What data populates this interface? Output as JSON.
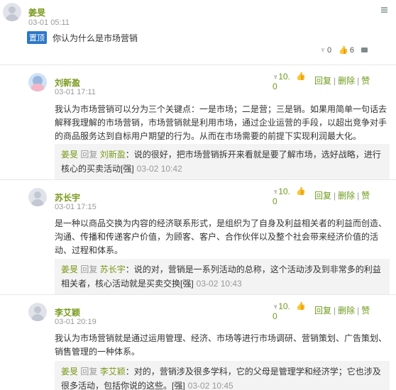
{
  "topic": {
    "author": "姜旻",
    "time": "03-01 05:11",
    "pin_label": "置顶",
    "title": "你认为什么是市场营销",
    "stats": {
      "pins": "0",
      "likes": "6",
      "comments": ""
    }
  },
  "posts": [
    {
      "author": "刘新盈",
      "time": "03-01 17:11",
      "vote_a": "10.",
      "vote_b": "0",
      "actions": {
        "reply": "回复",
        "delete": "删除",
        "thumbs": "赞"
      },
      "content": "我认为市场营销可以分为三个关键点：一是市场；二是营；三是销。如果用简单一句话去解释我理解的市场营销，市场营销就是利用市场，通过企业运营的手段，以超出竞争对手的商品服务达到自标用户期望的行为。从而在市场需要的前提下实现利润最大化。",
      "reply": {
        "from": "姜旻",
        "word": "回复",
        "to": "刘新盈",
        "text": "：说的很好，把市场营销拆开来看就是要了解市场，选好战略，进行核心的买卖活动[强]",
        "time": "03-02 10:42"
      }
    },
    {
      "author": "苏长宇",
      "time": "03-01 17:15",
      "vote_a": "10.",
      "vote_b": "0",
      "actions": {
        "reply": "回复",
        "delete": "删除",
        "thumbs": "赞"
      },
      "content": "是一种以商品交换为内容的经济联系形式，是组织为了自身及利益相关者的利益而创造、沟通、传播和传递客户价值，为顾客、客户、合作伙伴以及整个社会带来经济价值的活动、过程和体系。",
      "reply": {
        "from": "姜旻",
        "word": "回复",
        "to": "苏长宇",
        "text": "：说的对，营销是一系列活动的总称，这个活动涉及到非常多的利益相关者，核心活动就是买卖交换[强]",
        "time": "03-02 10:43"
      }
    },
    {
      "author": "李艾颖",
      "time": "03-01 20:19",
      "vote_a": "10.",
      "vote_b": "0",
      "actions": {
        "reply": "回复",
        "delete": "删除",
        "thumbs": "赞"
      },
      "content": "我认为市场营销就是通过运用管理、经济、市场等进行市场调研、营销策划、广告策划、销售管理的一种体系。",
      "reply": {
        "from": "姜旻",
        "word": "回复",
        "to": "李艾颖",
        "text": "：对的，营销涉及很多学科，它的父母是管理学和经济学；它也涉及很多活动，包括你说的这些。[强]",
        "time": "03-02 10:45"
      }
    }
  ]
}
